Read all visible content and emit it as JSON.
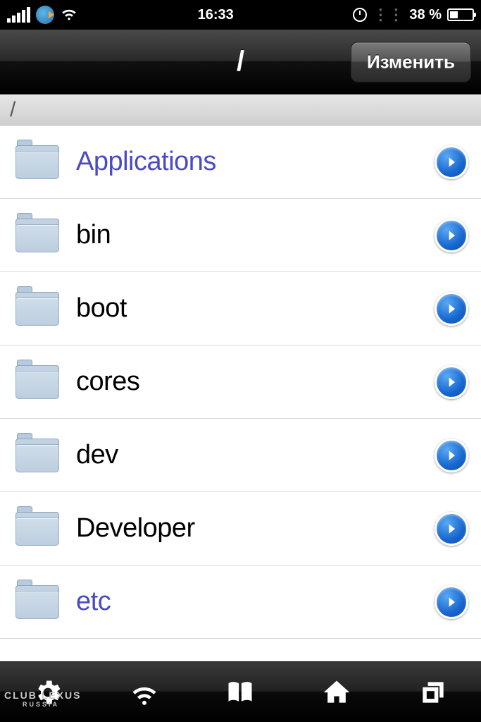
{
  "status": {
    "time": "16:33",
    "battery_pct": "38 %"
  },
  "nav": {
    "title": "/",
    "edit_label": "Изменить"
  },
  "path": "/",
  "items": [
    {
      "name": "Applications",
      "link": true
    },
    {
      "name": "bin",
      "link": false
    },
    {
      "name": "boot",
      "link": false
    },
    {
      "name": "cores",
      "link": false
    },
    {
      "name": "dev",
      "link": false
    },
    {
      "name": "Developer",
      "link": false
    },
    {
      "name": "etc",
      "link": true
    }
  ],
  "watermark": {
    "line1": "CLUB LEXUS",
    "line2": "RUSSIA"
  }
}
